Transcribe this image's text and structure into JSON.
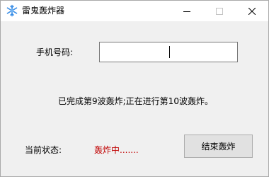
{
  "window": {
    "title": "雷鬼轰炸器",
    "icons": {
      "app": "snowflake-icon",
      "minimize": "minimize-icon",
      "maximize": "maximize-icon",
      "close": "close-icon"
    }
  },
  "form": {
    "phone_label": "手机号码:",
    "phone_value": "",
    "phone_placeholder": ""
  },
  "progress": {
    "message": "已完成第9波轰炸;正在进行第10波轰炸。"
  },
  "status": {
    "label": "当前状态:",
    "value": "轰炸中......."
  },
  "actions": {
    "stop_label": "结束轰炸"
  },
  "colors": {
    "status_text": "#c00000",
    "icon_blue": "#3a8ee6",
    "button_face": "#e1e1e1",
    "window_bg": "#f0f0f0"
  }
}
